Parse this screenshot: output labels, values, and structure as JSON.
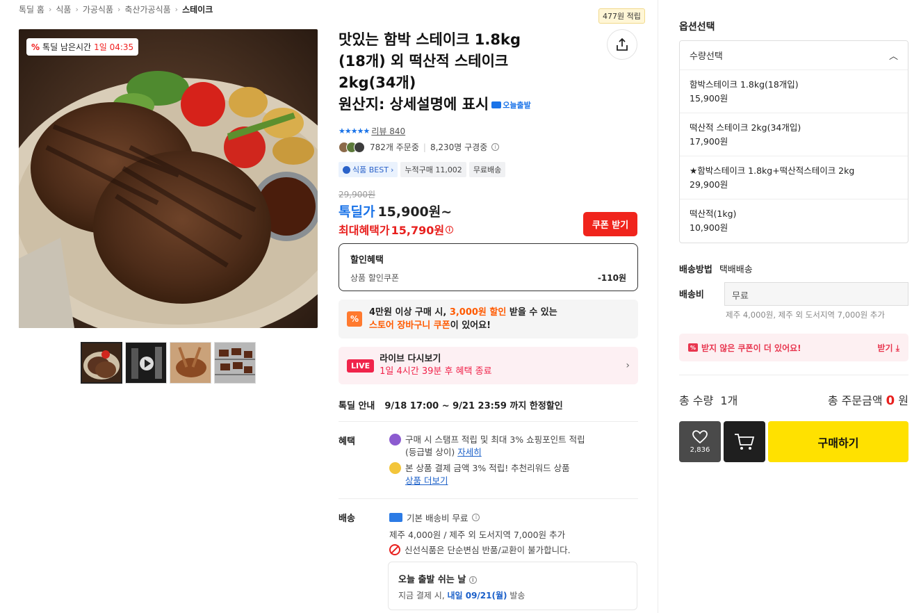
{
  "breadcrumb": [
    "톡딜 홈",
    "식품",
    "가공식품",
    "축산가공식품",
    "스테이크"
  ],
  "timer": {
    "label": "톡딜 남은시간",
    "time": "1일 04:35"
  },
  "point_tag": "477원 적립",
  "title": {
    "line1": "맛있는 함박 스테이크 1.8kg",
    "line2": "(18개) 외 떡산적 스테이크",
    "line3": "2kg(34개)",
    "line4": "원산지: 상세설명에 표시",
    "badge": "오늘출발"
  },
  "review": {
    "stars": "★★★★★",
    "label": "리뷰 840"
  },
  "orders": {
    "count": "782개 주문중",
    "subs": "8,230명 구경중"
  },
  "tags": [
    "식품 BEST",
    "누적구매 11,002",
    "무료배송"
  ],
  "price": {
    "original": "29,900원",
    "deal_label": "톡딜가",
    "deal": "15,900원~",
    "max_label": "최대혜택가",
    "max": "15,790원",
    "coupon_button": "쿠폰 받기"
  },
  "discount": {
    "header": "할인혜택",
    "item": "상품 할인쿠폰",
    "amount": "-110원"
  },
  "store_promo": {
    "line1_a": "4만원 이상 구매 시, ",
    "line1_hl": "3,000원 할인",
    "line1_b": " 받을 수 있는",
    "line2_hl": "스토어 장바구니 쿠폰",
    "line2_b": "이 있어요!"
  },
  "live": {
    "badge": "LIVE",
    "title": "라이브 다시보기",
    "sub": "1일 4시간 39분 후 혜택 종료"
  },
  "deal_info": {
    "label": "톡딜 안내",
    "text": "9/18 17:00 ~ 9/21 23:59 까지 한정할인"
  },
  "benefits": {
    "label": "혜택",
    "item1_a": "구매 시 스탬프 적립 및 최대 3% 쇼핑포인트 적립",
    "item1_b": "(등급별 상이) ",
    "item1_link": "자세히",
    "item2_a": "본 상품 결제 금액 3% 적립! 추천리워드 상품",
    "item2_link": "상품 더보기"
  },
  "shipping": {
    "label": "배송",
    "base": "기본 배송비 무료",
    "extra": "제주 4,000원 / 제주 외 도서지역 7,000원 추가",
    "notice": "신선식품은 단순변심 반품/교환이 불가합니다.",
    "rest_title": "오늘 출발 쉬는 날",
    "rest_a": "지금 결제 시, ",
    "rest_b": "내일 09/21(월)",
    "rest_c": " 발송"
  },
  "options": {
    "title": "옵션선택",
    "select": "수량선택",
    "items": [
      {
        "name": "함박스테이크 1.8kg(18개입)",
        "price": "15,900원"
      },
      {
        "name": "떡산적 스테이크 2kg(34개입)",
        "price": "17,900원"
      },
      {
        "name": "★함박스테이크 1.8kg+떡산적스테이크 2kg",
        "price": "29,900원"
      },
      {
        "name": "떡산적(1kg)",
        "price": "10,900원"
      }
    ]
  },
  "delivery": {
    "method_label": "배송방법",
    "method": "택배배송",
    "fee_label": "배송비",
    "fee": "무료",
    "fee_note": "제주 4,000원, 제주 외 도서지역 7,000원 추가"
  },
  "coupon_alert": {
    "text": "받지 않은 쿠폰이 더 있어요!",
    "action": "받기"
  },
  "totals": {
    "qty_label": "총 수량",
    "qty": "1개",
    "amount_label": "총 주문금액",
    "amount": "0",
    "unit": "원"
  },
  "actions": {
    "likes": "2,836",
    "buy": "구매하기"
  },
  "colors": {
    "accent_blue": "#1a73e8",
    "accent_red": "#e8201e",
    "buy_yellow": "#ffe100"
  }
}
